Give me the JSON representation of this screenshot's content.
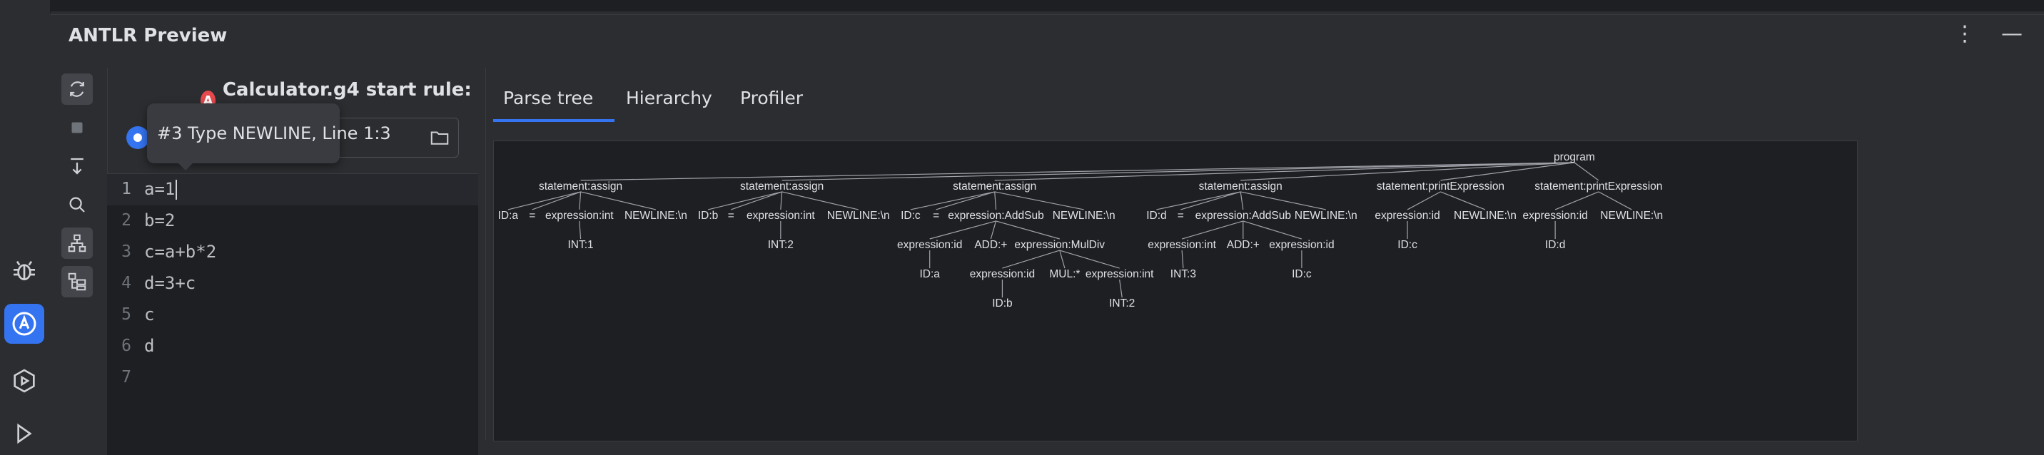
{
  "tool_window": {
    "title": "ANTLR Preview",
    "more_label": "⋮",
    "minimize_label": "—"
  },
  "grammar": {
    "title": "Calculator.g4 start rule: program",
    "badge": "A"
  },
  "tooltip": {
    "text": "#3 Type NEWLINE, Line 1:3"
  },
  "editor": {
    "lines": [
      {
        "num": "1",
        "code": "a=1"
      },
      {
        "num": "2",
        "code": "b=2"
      },
      {
        "num": "3",
        "code": "c=a+b*2"
      },
      {
        "num": "4",
        "code": "d=3+c"
      },
      {
        "num": "5",
        "code": "c"
      },
      {
        "num": "6",
        "code": "d"
      },
      {
        "num": "7",
        "code": ""
      }
    ]
  },
  "tabs": [
    {
      "label": "Parse tree",
      "active": true
    },
    {
      "label": "Hierarchy",
      "active": false
    },
    {
      "label": "Profiler",
      "active": false
    }
  ],
  "parse_tree": {
    "nodes": [
      {
        "id": "root",
        "label": "program"
      },
      {
        "id": "s1",
        "label": "statement:assign"
      },
      {
        "id": "s2",
        "label": "statement:assign"
      },
      {
        "id": "s3",
        "label": "statement:assign"
      },
      {
        "id": "s4",
        "label": "statement:assign"
      },
      {
        "id": "s5",
        "label": "statement:printExpression"
      },
      {
        "id": "s6",
        "label": "statement:printExpression"
      },
      {
        "id": "s1a",
        "label": "ID:a"
      },
      {
        "id": "s1b",
        "label": "="
      },
      {
        "id": "s1c",
        "label": "expression:int"
      },
      {
        "id": "s1d",
        "label": "NEWLINE:\\n"
      },
      {
        "id": "s1e",
        "label": "INT:1"
      },
      {
        "id": "s2a",
        "label": "ID:b"
      },
      {
        "id": "s2b",
        "label": "="
      },
      {
        "id": "s2c",
        "label": "expression:int"
      },
      {
        "id": "s2d",
        "label": "NEWLINE:\\n"
      },
      {
        "id": "s2e",
        "label": "INT:2"
      },
      {
        "id": "s3a",
        "label": "ID:c"
      },
      {
        "id": "s3b",
        "label": "="
      },
      {
        "id": "s3c",
        "label": "expression:AddSub"
      },
      {
        "id": "s3d",
        "label": "NEWLINE:\\n"
      },
      {
        "id": "s3e",
        "label": "expression:id"
      },
      {
        "id": "s3f",
        "label": "ADD:+"
      },
      {
        "id": "s3g",
        "label": "expression:MulDiv"
      },
      {
        "id": "s3h",
        "label": "ID:a"
      },
      {
        "id": "s3i",
        "label": "expression:id"
      },
      {
        "id": "s3j",
        "label": "MUL:*"
      },
      {
        "id": "s3k",
        "label": "expression:int"
      },
      {
        "id": "s3l",
        "label": "ID:b"
      },
      {
        "id": "s3m",
        "label": "INT:2"
      },
      {
        "id": "s4a",
        "label": "ID:d"
      },
      {
        "id": "s4b",
        "label": "="
      },
      {
        "id": "s4c",
        "label": "expression:AddSub"
      },
      {
        "id": "s4d",
        "label": "NEWLINE:\\n"
      },
      {
        "id": "s4e",
        "label": "expression:int"
      },
      {
        "id": "s4f",
        "label": "ADD:+"
      },
      {
        "id": "s4g",
        "label": "expression:id"
      },
      {
        "id": "s4h",
        "label": "INT:3"
      },
      {
        "id": "s4i",
        "label": "ID:c"
      },
      {
        "id": "s5a",
        "label": "expression:id"
      },
      {
        "id": "s5b",
        "label": "NEWLINE:\\n"
      },
      {
        "id": "s5c",
        "label": "ID:c"
      },
      {
        "id": "s6a",
        "label": "expression:id"
      },
      {
        "id": "s6b",
        "label": "NEWLINE:\\n"
      },
      {
        "id": "s6c",
        "label": "ID:d"
      }
    ],
    "edges": [
      [
        "root",
        "s1"
      ],
      [
        "root",
        "s2"
      ],
      [
        "root",
        "s3"
      ],
      [
        "root",
        "s4"
      ],
      [
        "root",
        "s5"
      ],
      [
        "root",
        "s6"
      ],
      [
        "s1",
        "s1a"
      ],
      [
        "s1",
        "s1b"
      ],
      [
        "s1",
        "s1c"
      ],
      [
        "s1",
        "s1d"
      ],
      [
        "s1c",
        "s1e"
      ],
      [
        "s2",
        "s2a"
      ],
      [
        "s2",
        "s2b"
      ],
      [
        "s2",
        "s2c"
      ],
      [
        "s2",
        "s2d"
      ],
      [
        "s2c",
        "s2e"
      ],
      [
        "s3",
        "s3a"
      ],
      [
        "s3",
        "s3b"
      ],
      [
        "s3",
        "s3c"
      ],
      [
        "s3",
        "s3d"
      ],
      [
        "s3c",
        "s3e"
      ],
      [
        "s3c",
        "s3f"
      ],
      [
        "s3c",
        "s3g"
      ],
      [
        "s3e",
        "s3h"
      ],
      [
        "s3g",
        "s3i"
      ],
      [
        "s3g",
        "s3j"
      ],
      [
        "s3g",
        "s3k"
      ],
      [
        "s3i",
        "s3l"
      ],
      [
        "s3k",
        "s3m"
      ],
      [
        "s4",
        "s4a"
      ],
      [
        "s4",
        "s4b"
      ],
      [
        "s4",
        "s4c"
      ],
      [
        "s4",
        "s4d"
      ],
      [
        "s4c",
        "s4e"
      ],
      [
        "s4c",
        "s4f"
      ],
      [
        "s4c",
        "s4g"
      ],
      [
        "s4e",
        "s4h"
      ],
      [
        "s4g",
        "s4i"
      ],
      [
        "s5",
        "s5a"
      ],
      [
        "s5",
        "s5b"
      ],
      [
        "s5a",
        "s5c"
      ],
      [
        "s6",
        "s6a"
      ],
      [
        "s6",
        "s6b"
      ],
      [
        "s6a",
        "s6c"
      ]
    ]
  },
  "icons": {
    "sidebar": [
      "debug-icon",
      "antlr-icon",
      "run-icon"
    ],
    "toolbar": [
      "refresh-icon",
      "stop-icon",
      "download-icon",
      "search-icon",
      "hierarchy-icon",
      "tree-view-icon"
    ]
  },
  "colors": {
    "accent": "#3574f0",
    "antlr_red": "#e5484d",
    "background": "#2b2d30",
    "editor_bg": "#1e1f22"
  }
}
